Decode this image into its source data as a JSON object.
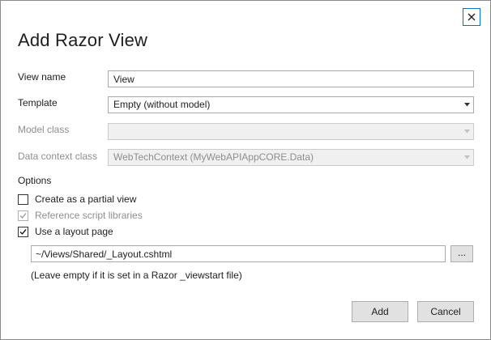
{
  "dialog": {
    "title": "Add Razor View",
    "close_icon": "close-icon"
  },
  "form": {
    "view_name": {
      "label": "View name",
      "value": "View"
    },
    "template": {
      "label": "Template",
      "value": "Empty (without model)"
    },
    "model_class": {
      "label": "Model class",
      "value": ""
    },
    "data_context_class": {
      "label": "Data context class",
      "value": "WebTechContext (MyWebAPIAppCORE.Data)"
    }
  },
  "options": {
    "label": "Options",
    "items": [
      {
        "label": "Create as a partial view",
        "checked": false,
        "enabled": true
      },
      {
        "label": "Reference script libraries",
        "checked": true,
        "enabled": false
      },
      {
        "label": "Use a layout page",
        "checked": true,
        "enabled": true
      }
    ],
    "layout_path": "~/Views/Shared/_Layout.cshtml",
    "browse_label": "...",
    "hint": "(Leave empty if it is set in a Razor _viewstart file)"
  },
  "buttons": {
    "add": "Add",
    "cancel": "Cancel"
  },
  "colors": {
    "close_border": "#0e70c0",
    "disabled_text": "#8e8e8e",
    "button_bg": "#e1e1e1"
  }
}
